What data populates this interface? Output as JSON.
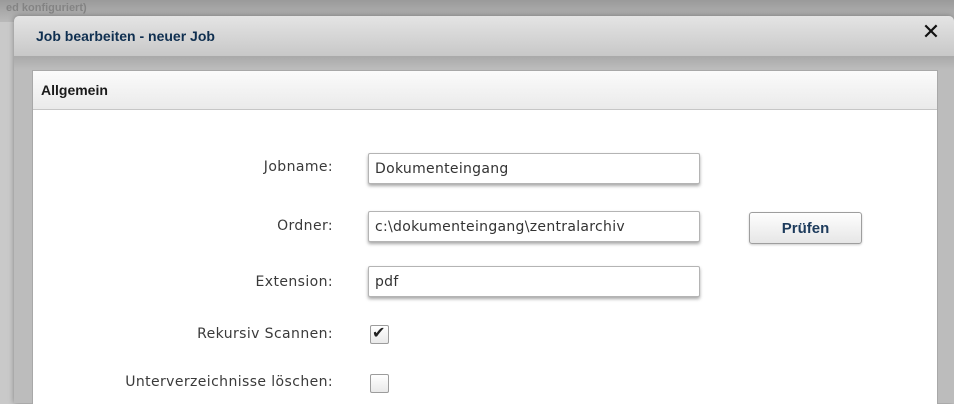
{
  "background": {
    "text": "ed konfiguriert)"
  },
  "dialog": {
    "title": "Job bearbeiten - neuer Job",
    "close_glyph": "✕"
  },
  "section": {
    "title": "Allgemein"
  },
  "form": {
    "jobname": {
      "label": "Jobname:",
      "value": "Dokumenteingang"
    },
    "ordner": {
      "label": "Ordner:",
      "value": "c:\\dokumenteingang\\zentralarchiv"
    },
    "extension": {
      "label": "Extension:",
      "value": "pdf"
    },
    "rekursiv": {
      "label": "Rekursiv Scannen:",
      "checked": true,
      "check_glyph": "✔"
    },
    "unterverzeichnisse": {
      "label": "Unterverzeichnisse löschen:",
      "checked": false
    }
  },
  "buttons": {
    "pruefen": "Prüfen"
  },
  "icons": {
    "close": "close-icon",
    "check": "checkmark-icon"
  },
  "colors": {
    "title": "#0f2f50",
    "button_text": "#1d3b5c"
  }
}
